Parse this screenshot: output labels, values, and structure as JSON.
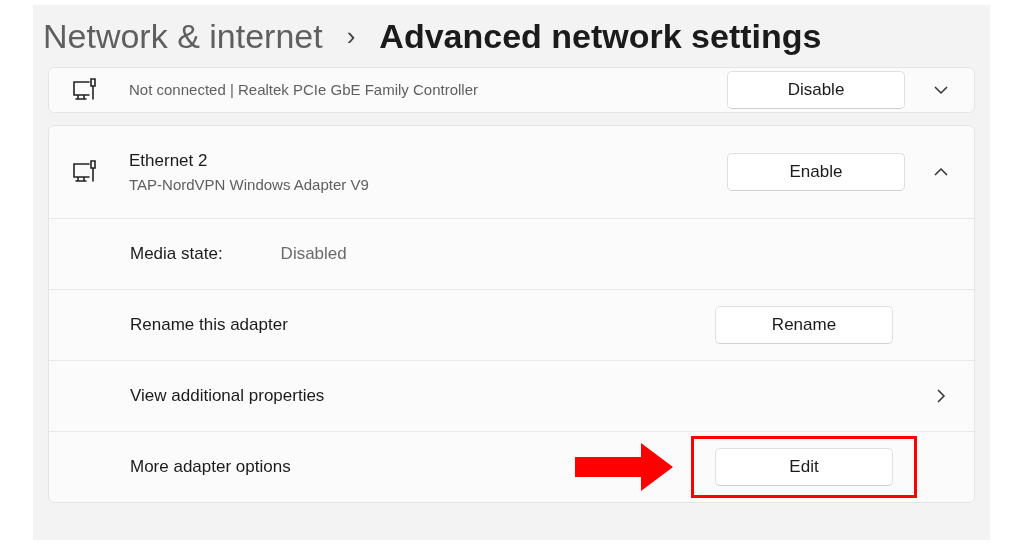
{
  "header": {
    "parent": "Network & internet",
    "separator": "›",
    "title": "Advanced network settings"
  },
  "adapters": [
    {
      "description": "Not connected | Realtek PCIe GbE Family Controller",
      "button": "Disable",
      "expanded": false
    },
    {
      "name": "Ethernet 2",
      "description": "TAP-NordVPN Windows Adapter V9",
      "button": "Enable",
      "expanded": true,
      "details": [
        {
          "kind": "info",
          "label": "Media state:",
          "value": "Disabled"
        },
        {
          "kind": "button",
          "label": "Rename this adapter",
          "button": "Rename",
          "highlighted": false
        },
        {
          "kind": "link",
          "label": "View additional properties"
        },
        {
          "kind": "button",
          "label": "More adapter options",
          "button": "Edit",
          "highlighted": true
        }
      ]
    }
  ]
}
